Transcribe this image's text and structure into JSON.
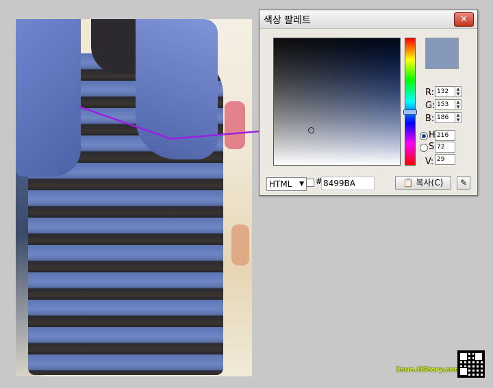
{
  "window": {
    "title": "색상 팔레트",
    "close_symbol": "✕",
    "swatch_color": "#8499BA"
  },
  "rgb": {
    "r_label": "R:",
    "g_label": "G:",
    "b_label": "B:",
    "r_value": "132",
    "g_value": "153",
    "b_value": "186"
  },
  "hsv": {
    "h_label": "H",
    "s_label": "S",
    "v_label": "V:",
    "h_value": "216",
    "s_value": "72",
    "v_value": "29",
    "selected": "H"
  },
  "bottom": {
    "format_select": "HTML",
    "hash": "#",
    "hex_value": "8499BA",
    "copy_label": "복사(C)",
    "copy_icon": "clipboard-icon",
    "dropper_icon": "eyedropper-icon"
  },
  "watermark": {
    "text": "3sun.tiStory.com"
  },
  "colors": {
    "arrow": "#9b1fe0",
    "sample": "#8499BA"
  }
}
